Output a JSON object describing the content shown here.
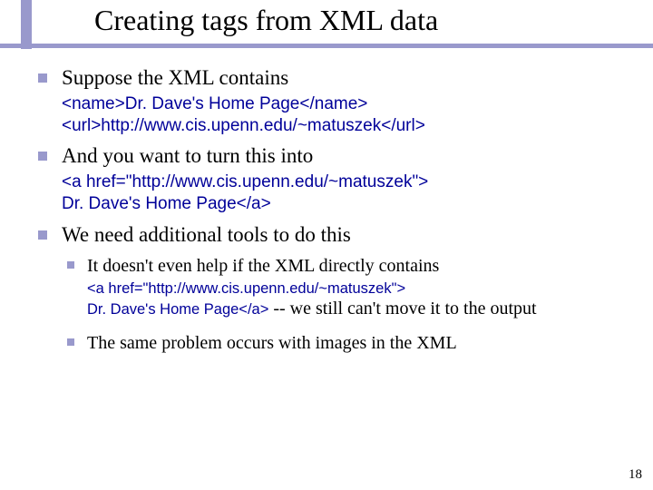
{
  "title": "Creating tags from XML data",
  "page_number": "18",
  "items": [
    {
      "text": "Suppose the XML contains",
      "code": "<name>Dr. Dave's Home Page</name>\n<url>http://www.cis.upenn.edu/~matuszek</url>"
    },
    {
      "text": "And you want to turn this into",
      "code": "<a href=\"http://www.cis.upenn.edu/~matuszek\">\nDr. Dave's Home Page</a>"
    },
    {
      "text": "We need additional tools to do this",
      "sub": [
        {
          "text": "It doesn't even help if the XML directly contains",
          "code": "<a href=\"http://www.cis.upenn.edu/~matuszek\">\nDr. Dave's Home Page</a>",
          "tail": " -- we still can't move it to the output"
        },
        {
          "text": "The same problem occurs with images in the XML"
        }
      ]
    }
  ]
}
